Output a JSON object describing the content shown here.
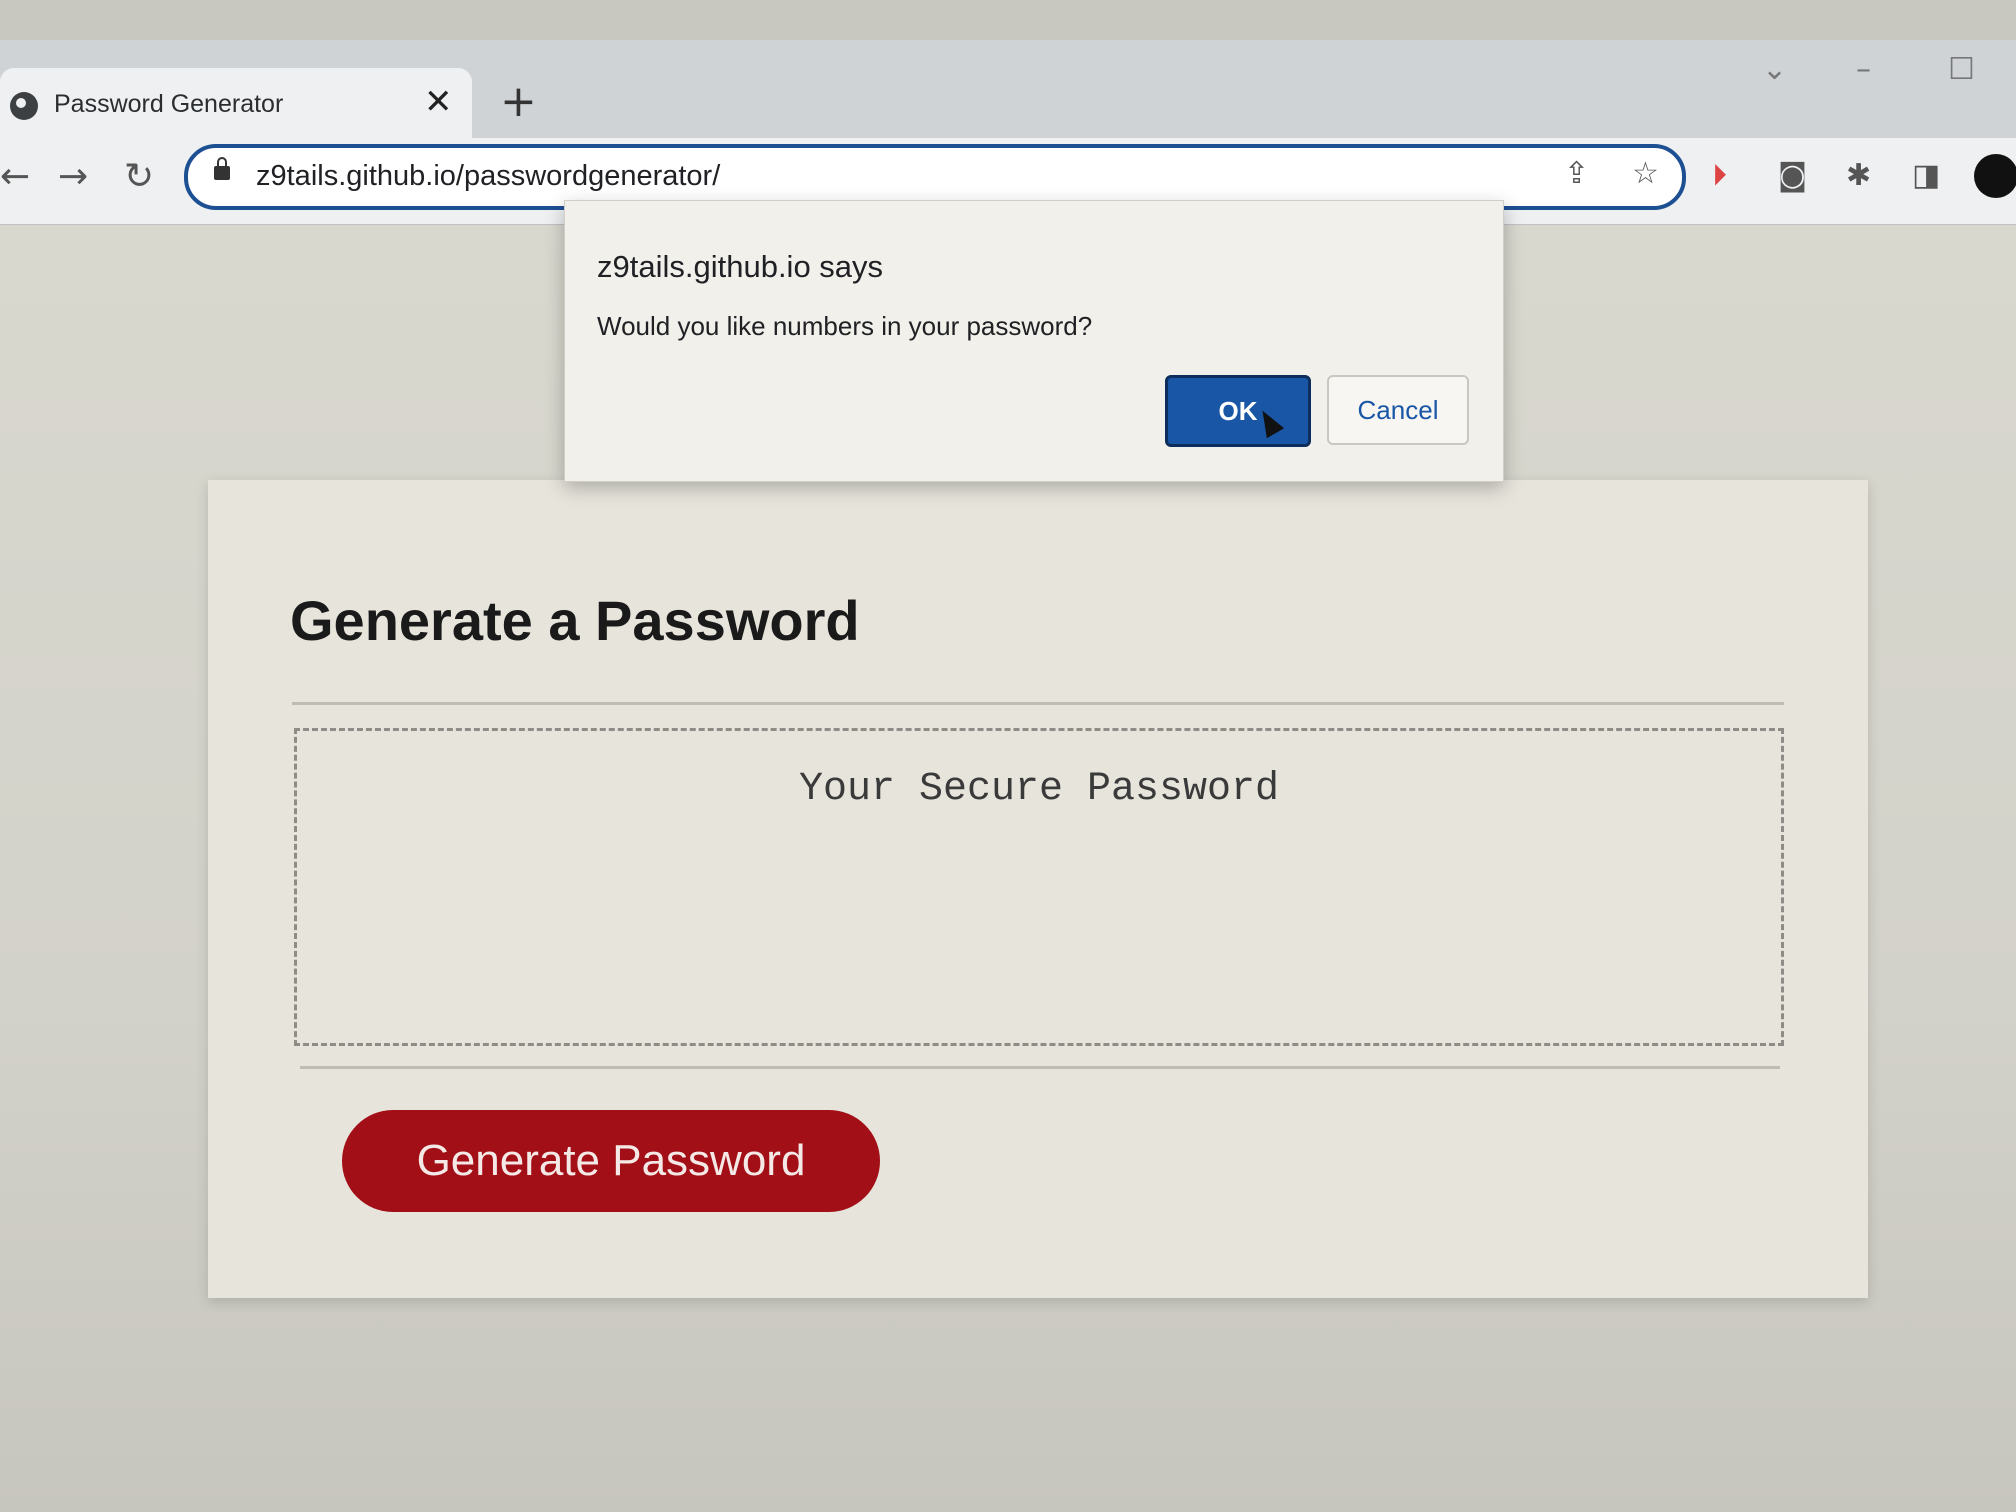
{
  "browser": {
    "tab": {
      "title": "Password Generator",
      "close_glyph": "✕",
      "icon": "globe-icon"
    },
    "new_tab_glyph": "+",
    "window_controls": {
      "dropdown": "⌄",
      "minimize": "–",
      "maximize": "☐"
    },
    "nav": {
      "back": "←",
      "forward": "→",
      "reload": "↻"
    },
    "url": "z9tails.github.io/passwordgenerator/",
    "omnibox_icons": {
      "share": "⇪",
      "bookmark": "☆"
    },
    "extension_icons": [
      "video-extension-icon",
      "camera-icon",
      "puzzle-icon",
      "sidebar-icon"
    ],
    "extension_glyphs": {
      "video": "⏵",
      "camera": "◙",
      "puzzle": "✱",
      "sidebar": "◨"
    },
    "accent_color": "#1d4f93"
  },
  "dialog": {
    "title": "z9tails.github.io says",
    "message": "Would you like numbers in your password?",
    "ok_label": "OK",
    "cancel_label": "Cancel",
    "ok_color": "#1a56a6"
  },
  "card": {
    "heading": "Generate a Password",
    "password_placeholder": "Your Secure Password",
    "generate_label": "Generate Password",
    "button_color": "#a30f17"
  }
}
